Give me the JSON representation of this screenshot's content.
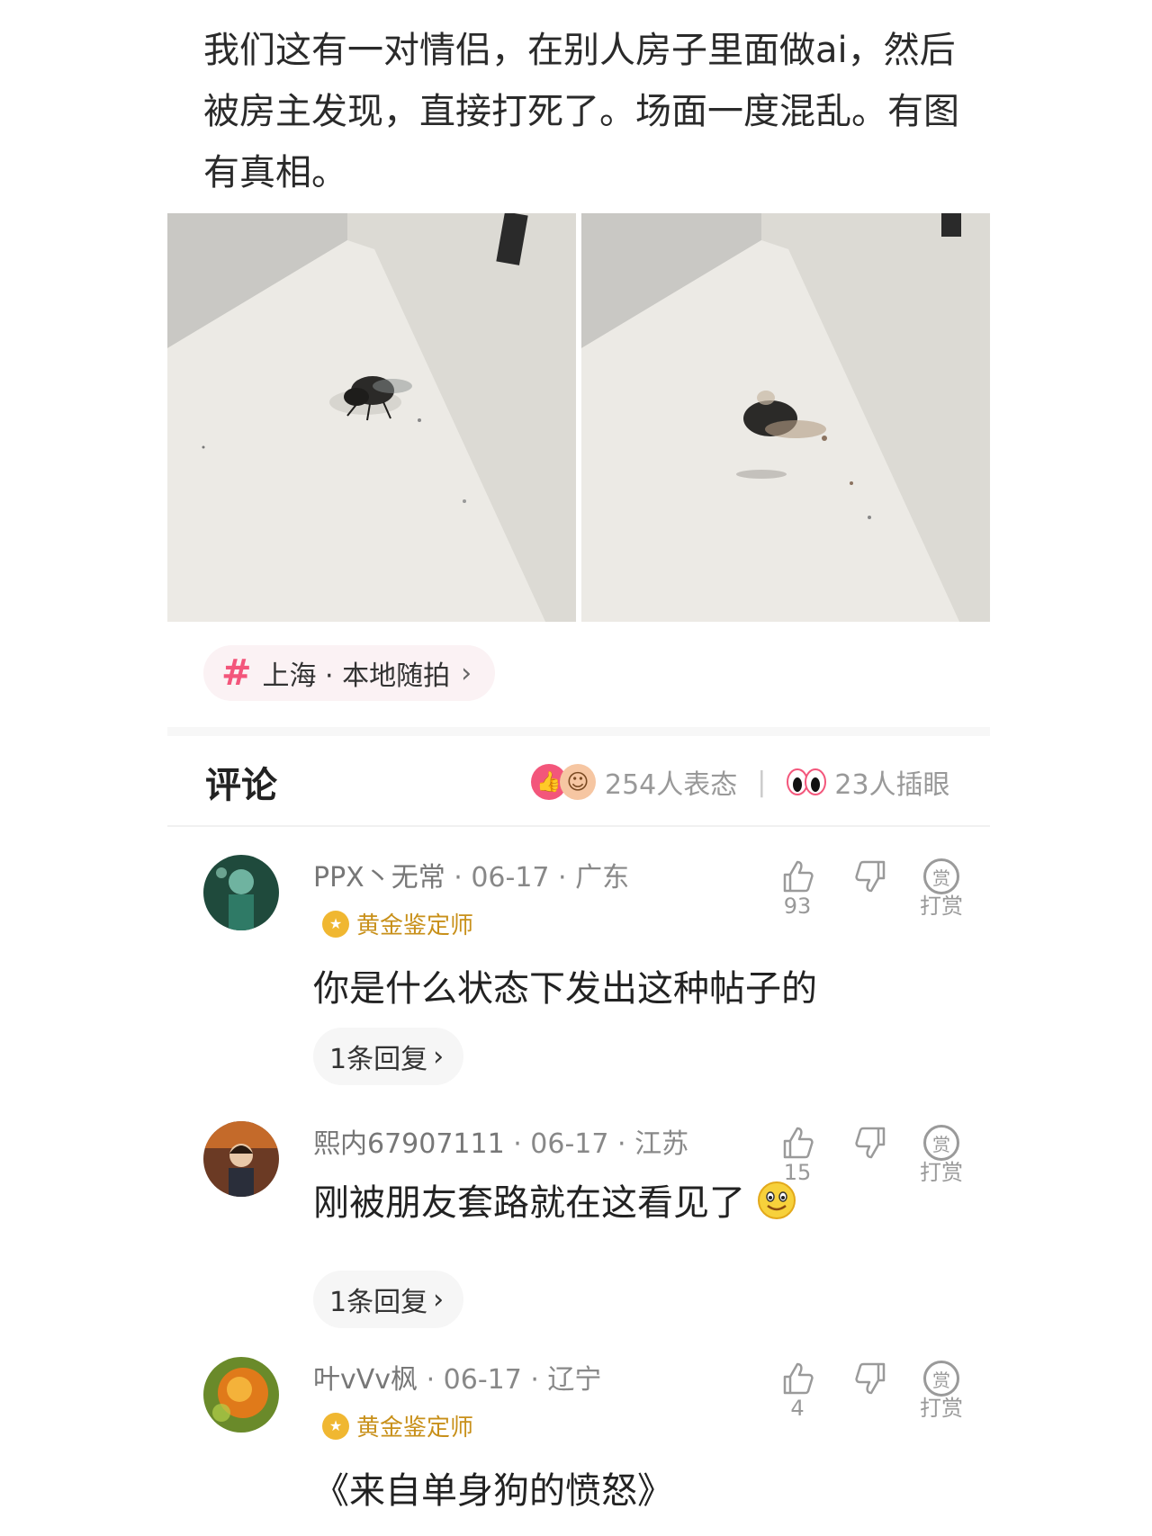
{
  "post": {
    "text": "我们这有一对情侣，在别人房子里面做ai，然后被房主发现，直接打死了。场面一度混乱。有图有真相。"
  },
  "topic": {
    "icon": "hash-icon",
    "label": "上海 · 本地随拍",
    "chevron": "›"
  },
  "comments_section": {
    "title": "评论",
    "reactions_count": "254人表态",
    "separator": "|",
    "eye_count": "23人插眼"
  },
  "comments": [
    {
      "username": "PPX丶无常",
      "meta": " · 06-17 · 广东",
      "badge": "黄金鉴定师",
      "text": "你是什么状态下发出这种帖子的",
      "likes": "93",
      "reward_label": "打赏",
      "reward_icon_text": "赏",
      "replies": "1条回复",
      "replies_chevron": "›"
    },
    {
      "username": "熙内67907111",
      "meta": " · 06-17 · 江苏",
      "text": "刚被朋友套路就在这看见了",
      "likes": "15",
      "reward_label": "打赏",
      "reward_icon_text": "赏",
      "replies": "1条回复",
      "replies_chevron": "›"
    },
    {
      "username": "叶vVv枫",
      "meta": " · 06-17 · 辽宁",
      "badge": "黄金鉴定师",
      "text": "《来自单身狗的愤怒》",
      "likes": "4",
      "reward_label": "打赏",
      "reward_icon_text": "赏"
    }
  ],
  "colors": {
    "accent_pink": "#f3567b",
    "gold": "#c8901a",
    "muted": "#999999"
  }
}
